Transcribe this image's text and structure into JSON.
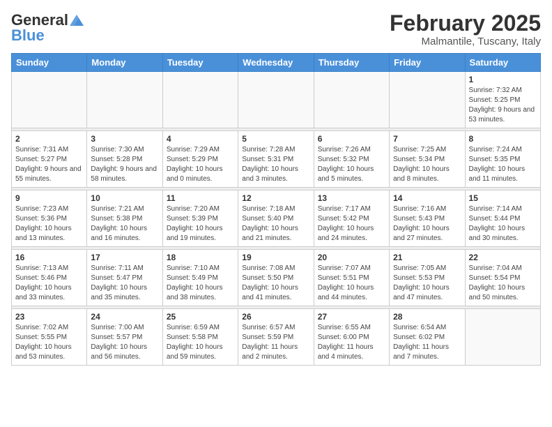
{
  "header": {
    "logo": {
      "general": "General",
      "blue": "Blue"
    },
    "title": "February 2025",
    "subtitle": "Malmantile, Tuscany, Italy"
  },
  "weekdays": [
    "Sunday",
    "Monday",
    "Tuesday",
    "Wednesday",
    "Thursday",
    "Friday",
    "Saturday"
  ],
  "weeks": [
    [
      {
        "day": "",
        "info": ""
      },
      {
        "day": "",
        "info": ""
      },
      {
        "day": "",
        "info": ""
      },
      {
        "day": "",
        "info": ""
      },
      {
        "day": "",
        "info": ""
      },
      {
        "day": "",
        "info": ""
      },
      {
        "day": "1",
        "info": "Sunrise: 7:32 AM\nSunset: 5:25 PM\nDaylight: 9 hours and 53 minutes."
      }
    ],
    [
      {
        "day": "2",
        "info": "Sunrise: 7:31 AM\nSunset: 5:27 PM\nDaylight: 9 hours and 55 minutes."
      },
      {
        "day": "3",
        "info": "Sunrise: 7:30 AM\nSunset: 5:28 PM\nDaylight: 9 hours and 58 minutes."
      },
      {
        "day": "4",
        "info": "Sunrise: 7:29 AM\nSunset: 5:29 PM\nDaylight: 10 hours and 0 minutes."
      },
      {
        "day": "5",
        "info": "Sunrise: 7:28 AM\nSunset: 5:31 PM\nDaylight: 10 hours and 3 minutes."
      },
      {
        "day": "6",
        "info": "Sunrise: 7:26 AM\nSunset: 5:32 PM\nDaylight: 10 hours and 5 minutes."
      },
      {
        "day": "7",
        "info": "Sunrise: 7:25 AM\nSunset: 5:34 PM\nDaylight: 10 hours and 8 minutes."
      },
      {
        "day": "8",
        "info": "Sunrise: 7:24 AM\nSunset: 5:35 PM\nDaylight: 10 hours and 11 minutes."
      }
    ],
    [
      {
        "day": "9",
        "info": "Sunrise: 7:23 AM\nSunset: 5:36 PM\nDaylight: 10 hours and 13 minutes."
      },
      {
        "day": "10",
        "info": "Sunrise: 7:21 AM\nSunset: 5:38 PM\nDaylight: 10 hours and 16 minutes."
      },
      {
        "day": "11",
        "info": "Sunrise: 7:20 AM\nSunset: 5:39 PM\nDaylight: 10 hours and 19 minutes."
      },
      {
        "day": "12",
        "info": "Sunrise: 7:18 AM\nSunset: 5:40 PM\nDaylight: 10 hours and 21 minutes."
      },
      {
        "day": "13",
        "info": "Sunrise: 7:17 AM\nSunset: 5:42 PM\nDaylight: 10 hours and 24 minutes."
      },
      {
        "day": "14",
        "info": "Sunrise: 7:16 AM\nSunset: 5:43 PM\nDaylight: 10 hours and 27 minutes."
      },
      {
        "day": "15",
        "info": "Sunrise: 7:14 AM\nSunset: 5:44 PM\nDaylight: 10 hours and 30 minutes."
      }
    ],
    [
      {
        "day": "16",
        "info": "Sunrise: 7:13 AM\nSunset: 5:46 PM\nDaylight: 10 hours and 33 minutes."
      },
      {
        "day": "17",
        "info": "Sunrise: 7:11 AM\nSunset: 5:47 PM\nDaylight: 10 hours and 35 minutes."
      },
      {
        "day": "18",
        "info": "Sunrise: 7:10 AM\nSunset: 5:49 PM\nDaylight: 10 hours and 38 minutes."
      },
      {
        "day": "19",
        "info": "Sunrise: 7:08 AM\nSunset: 5:50 PM\nDaylight: 10 hours and 41 minutes."
      },
      {
        "day": "20",
        "info": "Sunrise: 7:07 AM\nSunset: 5:51 PM\nDaylight: 10 hours and 44 minutes."
      },
      {
        "day": "21",
        "info": "Sunrise: 7:05 AM\nSunset: 5:53 PM\nDaylight: 10 hours and 47 minutes."
      },
      {
        "day": "22",
        "info": "Sunrise: 7:04 AM\nSunset: 5:54 PM\nDaylight: 10 hours and 50 minutes."
      }
    ],
    [
      {
        "day": "23",
        "info": "Sunrise: 7:02 AM\nSunset: 5:55 PM\nDaylight: 10 hours and 53 minutes."
      },
      {
        "day": "24",
        "info": "Sunrise: 7:00 AM\nSunset: 5:57 PM\nDaylight: 10 hours and 56 minutes."
      },
      {
        "day": "25",
        "info": "Sunrise: 6:59 AM\nSunset: 5:58 PM\nDaylight: 10 hours and 59 minutes."
      },
      {
        "day": "26",
        "info": "Sunrise: 6:57 AM\nSunset: 5:59 PM\nDaylight: 11 hours and 2 minutes."
      },
      {
        "day": "27",
        "info": "Sunrise: 6:55 AM\nSunset: 6:00 PM\nDaylight: 11 hours and 4 minutes."
      },
      {
        "day": "28",
        "info": "Sunrise: 6:54 AM\nSunset: 6:02 PM\nDaylight: 11 hours and 7 minutes."
      },
      {
        "day": "",
        "info": ""
      }
    ]
  ]
}
